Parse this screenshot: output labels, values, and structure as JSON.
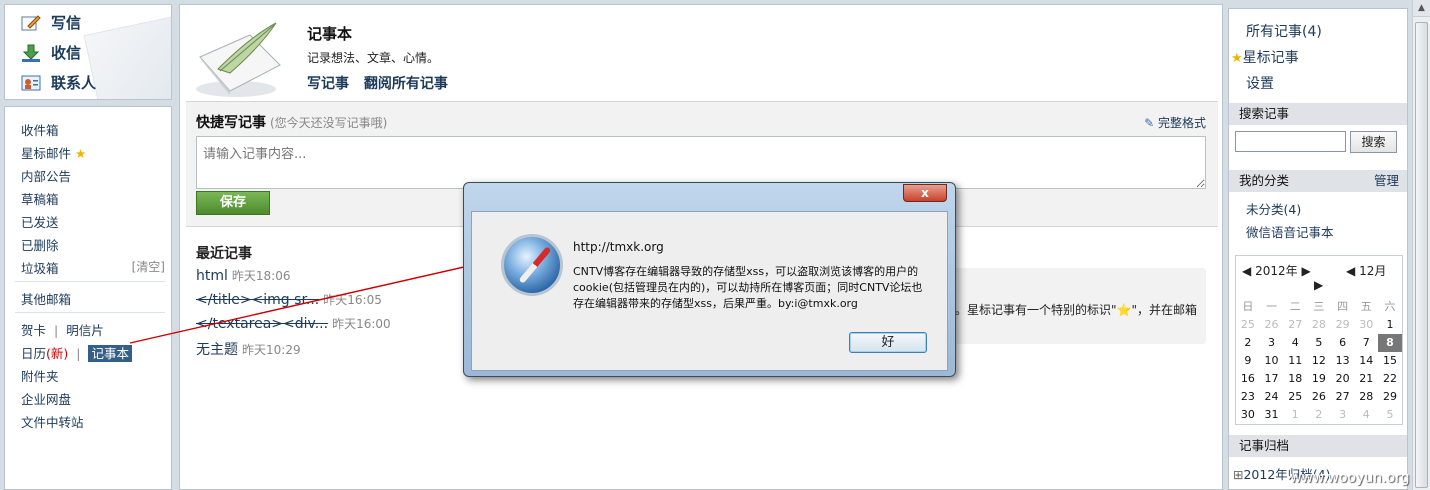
{
  "compose": [
    {
      "label": "写信",
      "icon": "pencil-icon"
    },
    {
      "label": "收信",
      "icon": "download-icon"
    },
    {
      "label": "联系人",
      "icon": "contacts-icon"
    }
  ],
  "folders": {
    "inbox": "收件箱",
    "starred": "星标邮件",
    "notice": "内部公告",
    "drafts": "草稿箱",
    "sent": "已发送",
    "deleted": "已删除",
    "junk": "垃圾箱",
    "clear": "[清空]",
    "other": "其他邮箱",
    "card": "贺卡",
    "postcard": "明信片",
    "calendar": "日历",
    "calendar_new": "(新)",
    "notebook": "记事本",
    "attachments": "附件夹",
    "netdisk": "企业网盘",
    "transfer": "文件中转站"
  },
  "notebook": {
    "title": "记事本",
    "subtitle": "记录想法、文章、心情。",
    "write_link": "写记事",
    "browse_link": "翻阅所有记事"
  },
  "quick": {
    "title": "快捷写记事",
    "hint": "(您今天还没写记事哦)",
    "full_format": "完整格式",
    "placeholder": "请输入记事内容...",
    "save": "保存"
  },
  "recent": {
    "title": "最近记事",
    "items": [
      {
        "name": "html",
        "time": "昨天18:06"
      },
      {
        "name": "</title><img sr...",
        "time": "昨天16:05"
      },
      {
        "name": "</textarea><div...",
        "time": "昨天16:00"
      },
      {
        "name": "无主题",
        "time": "昨天10:29"
      }
    ],
    "tip": "。星标记事有一个特别的标识\"⭐\"，并在邮箱"
  },
  "right": {
    "all_notes": "所有记事(4)",
    "starred_notes": "星标记事",
    "settings": "设置",
    "search_head": "搜索记事",
    "search_btn": "搜索",
    "category_head": "我的分类",
    "manage": "管理",
    "uncategorized": "未分类(4)",
    "voice": "微信语音记事本",
    "archive_head": "记事归档",
    "archive_item": "2012年归档(4)"
  },
  "calendar": {
    "year": "2012年",
    "month": "12月",
    "weekdays": [
      "日",
      "一",
      "二",
      "三",
      "四",
      "五",
      "六"
    ],
    "rows": [
      [
        "25",
        "26",
        "27",
        "28",
        "29",
        "30",
        "1"
      ],
      [
        "2",
        "3",
        "4",
        "5",
        "6",
        "7",
        "8"
      ],
      [
        "9",
        "10",
        "11",
        "12",
        "13",
        "14",
        "15"
      ],
      [
        "16",
        "17",
        "18",
        "19",
        "20",
        "21",
        "22"
      ],
      [
        "23",
        "24",
        "25",
        "26",
        "27",
        "28",
        "29"
      ],
      [
        "30",
        "31",
        "1",
        "2",
        "3",
        "4",
        "5"
      ]
    ],
    "today": "8"
  },
  "dialog": {
    "close": "x",
    "url": "http://tmxk.org",
    "message": "CNTV博客存在编辑器导致的存储型xss，可以盗取浏览该博客的用户的cookie(包括管理员在内的)，可以劫持所在博客页面；同时CNTV论坛也存在编辑器带来的存储型xss，后果严重。by:i@tmxk.org",
    "ok": "好"
  },
  "watermark": "www.wooyun.org",
  "colors": {
    "link": "#1c3a5a",
    "save": "#4c8a2c",
    "arrow": "#cc0000"
  }
}
